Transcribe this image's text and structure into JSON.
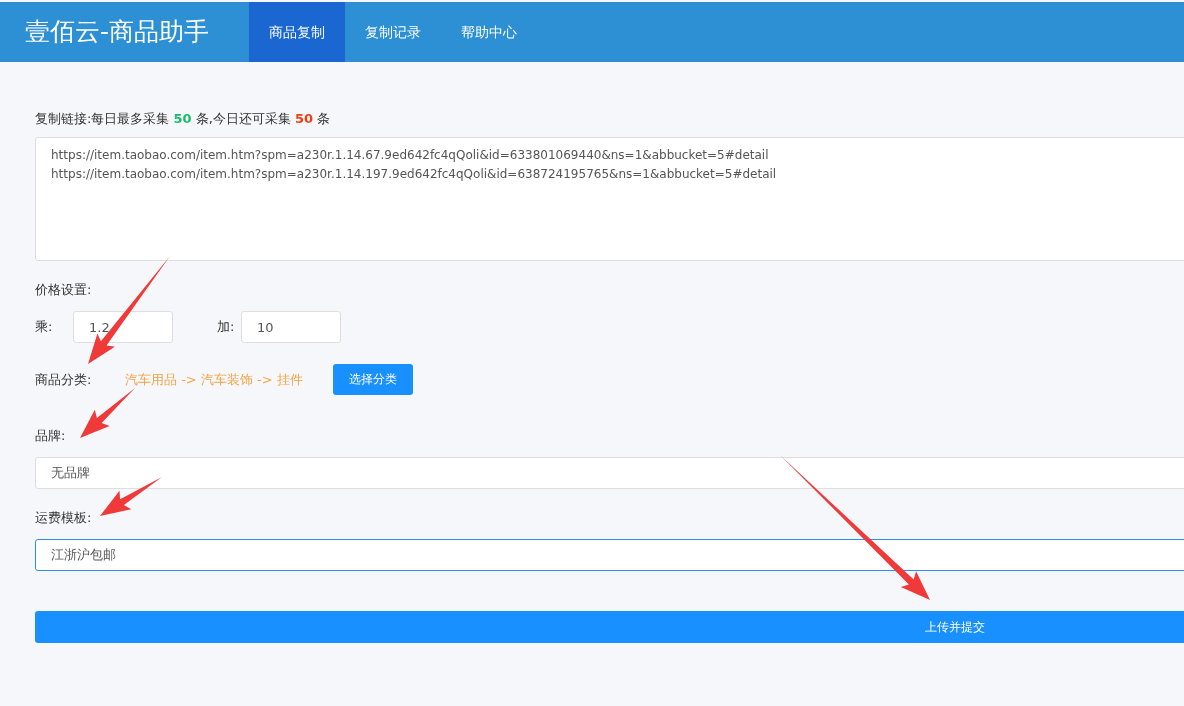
{
  "header": {
    "title": "壹佰云-商品助手"
  },
  "nav_tabs": [
    {
      "label": "商品复制",
      "selected": true
    },
    {
      "label": "复制记录",
      "selected": false
    },
    {
      "label": "帮助中心",
      "selected": false
    }
  ],
  "quota": {
    "prefix": "复制链接:每日最多采集",
    "max_count": "50",
    "middle": "条,今日还可采集",
    "remaining_count": "50",
    "suffix": "条"
  },
  "links_field": {
    "lines": [
      "https://item.taobao.com/item.htm?spm=a230r.1.14.67.9ed642fc4qQoli&id=633801069440&ns=1&abbucket=5#detail",
      "https://item.taobao.com/item.htm?spm=a230r.1.14.197.9ed642fc4qQoli&id=638724195765&ns=1&abbucket=5#detail"
    ]
  },
  "price": {
    "label": "价格设置:",
    "multiply_label": "乘:",
    "multiply_value": "1.2",
    "add_label": "加:",
    "add_value": "10"
  },
  "category": {
    "label": "商品分类:",
    "path": "汽车用品 -> 汽车装饰 -> 挂件",
    "button": "选择分类"
  },
  "brand": {
    "label": "品牌:",
    "value": "无品牌",
    "focused": false
  },
  "shipping": {
    "label": "运费模板:",
    "value": "江浙沪包邮",
    "focused": true
  },
  "submit_button": "上传并提交"
}
